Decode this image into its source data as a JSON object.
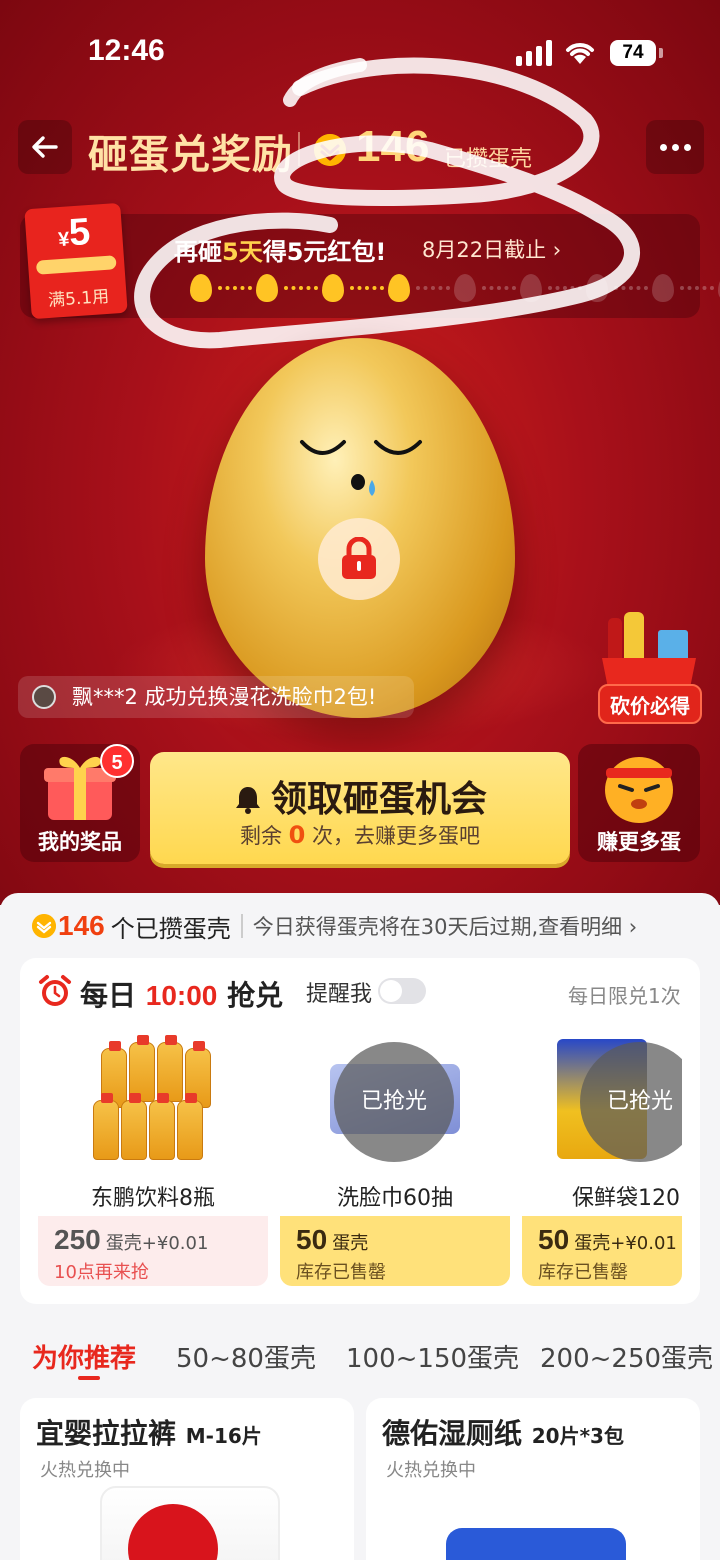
{
  "status_bar": {
    "time": "12:46",
    "battery": "74"
  },
  "header": {
    "title": "砸蛋兑奖励",
    "shell_count": "146",
    "shell_label": "已攒蛋壳"
  },
  "progress": {
    "red_packet_currency": "¥",
    "red_packet_amount": "5",
    "red_packet_condition": "满5.1用",
    "title_prefix": "再砸",
    "title_highlight": "5天",
    "title_suffix": "得5元红包!",
    "deadline": "8月22日截止 ›",
    "eggs_filled": 4,
    "eggs_total": 9
  },
  "ticker": {
    "text": "飘***2 成功兑换漫花洗脸巾2包!"
  },
  "cart": {
    "label": "砍价必得"
  },
  "prizes": {
    "label": "我的奖品",
    "badge": "5"
  },
  "claim": {
    "title": "领取砸蛋机会",
    "sub_prefix": "剩余",
    "remaining": "0",
    "sub_suffix": "次，去赚更多蛋吧"
  },
  "earn": {
    "label": "赚更多蛋"
  },
  "shell_summary": {
    "count": "146",
    "label": "个已攒蛋壳",
    "info": "今日获得蛋壳将在30天后过期,查看明细 ›"
  },
  "flash_sale": {
    "title_prefix": "每日",
    "time": "10:00",
    "title_suffix": "抢兑",
    "remind": "提醒我",
    "limit": "每日限兑1次",
    "products": [
      {
        "name": "东鹏饮料8瓶",
        "price": "250",
        "unit": "蛋壳+¥0.01",
        "status": "10点再来抢",
        "sold_out": ""
      },
      {
        "name": "洗脸巾60抽",
        "price": "50",
        "unit": "蛋壳",
        "status": "库存已售罄",
        "sold_out": "已抢光"
      },
      {
        "name": "保鲜袋120",
        "price": "50",
        "unit": "蛋壳+¥0.01",
        "status": "库存已售罄",
        "sold_out": "已抢光"
      }
    ]
  },
  "tabs": [
    "为你推荐",
    "50~80蛋壳",
    "100~150蛋壳",
    "200~250蛋壳"
  ],
  "recommend": [
    {
      "name": "宜婴拉拉裤",
      "spec": "M-16片",
      "sub": "火热兑换中"
    },
    {
      "name": "德佑湿厕纸",
      "spec": "20片*3包",
      "sub": "火热兑换中"
    }
  ],
  "colors": {
    "hero_red": "#a8101a",
    "accent_red": "#e8281e",
    "gold": "#ffd84f"
  }
}
